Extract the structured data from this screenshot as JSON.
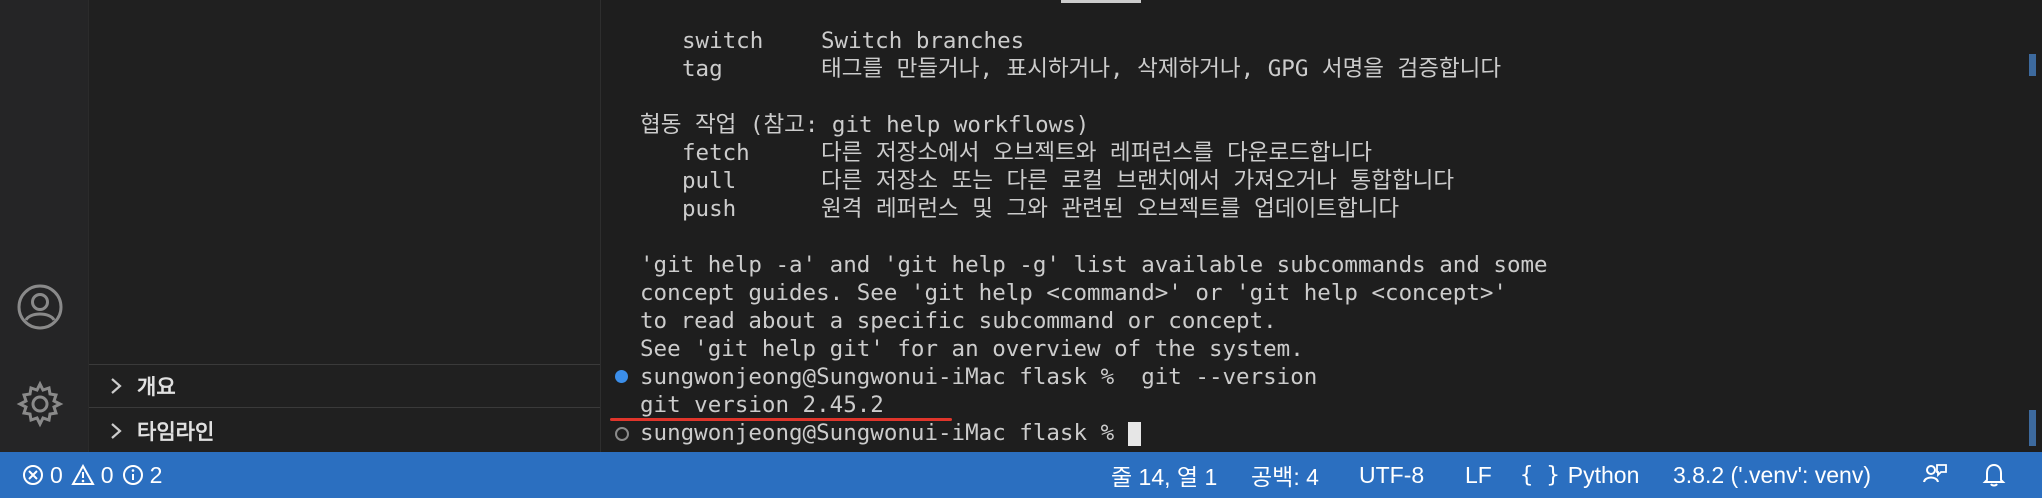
{
  "sidebar": {
    "sections": [
      {
        "label": "개요",
        "icon": "chevron-right-icon"
      },
      {
        "label": "타임라인",
        "icon": "chevron-right-icon"
      }
    ]
  },
  "terminal": {
    "lines": [
      {
        "cmd": "switch",
        "desc": "Switch branches"
      },
      {
        "cmd": "tag",
        "desc": "태그를 만들거나, 표시하거나, 삭제하거나, GPG 서명을 검증합니다"
      },
      {
        "text": ""
      },
      {
        "text": "협동 작업 (참고: git help workflows)"
      },
      {
        "cmd": "fetch",
        "desc": "다른 저장소에서 오브젝트와 레퍼런스를 다운로드합니다"
      },
      {
        "cmd": "pull",
        "desc": "다른 저장소 또는 다른 로컬 브랜치에서 가져오거나 통합합니다"
      },
      {
        "cmd": "push",
        "desc": "원격 레퍼런스 및 그와 관련된 오브젝트를 업데이트합니다"
      },
      {
        "text": ""
      },
      {
        "text": "'git help -a' and 'git help -g' list available subcommands and some"
      },
      {
        "text": "concept guides. See 'git help <command>' or 'git help <concept>'"
      },
      {
        "text": "to read about a specific subcommand or concept."
      },
      {
        "text": "See 'git help git' for an overview of the system."
      }
    ],
    "command_prompt": "sungwonjeong@Sungwonui-iMac flask %  git --version",
    "command_output": "git version 2.45.2",
    "current_prompt": "sungwonjeong@Sungwonui-iMac flask % ",
    "completed_marker_color": "#3b8eea",
    "highlight_underline_color": "#e0352b"
  },
  "statusbar": {
    "errors": "0",
    "warnings": "0",
    "infos": "2",
    "cursor_position": "줄 14, 열 1",
    "indentation": "공백: 4",
    "encoding": "UTF-8",
    "eol": "LF",
    "language": "Python",
    "interpreter": "3.8.2 ('.venv': venv)"
  }
}
